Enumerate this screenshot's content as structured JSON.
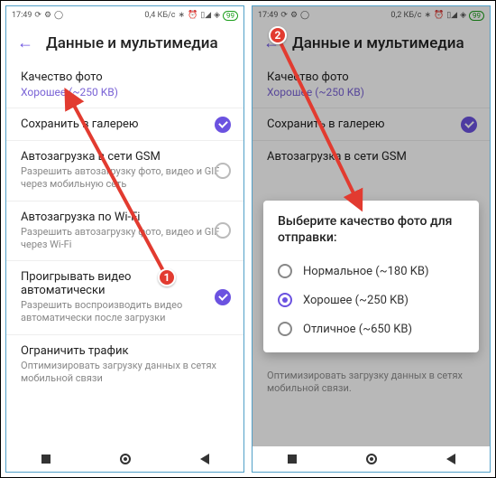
{
  "statusbar": {
    "time": "17:49",
    "net_left": "0,4 КБ/с",
    "net_right": "0,2 КБ/с",
    "batt_left": "99",
    "batt_right": "99"
  },
  "header": {
    "title": "Данные и мультимедиа"
  },
  "photo": {
    "label": "Качество фото",
    "value": "Хорошее (~250 KB)"
  },
  "gallery": {
    "label": "Сохранить в галерею"
  },
  "gsm": {
    "label": "Автозагрузка в сети GSM",
    "sub": "Разрешить автозагрузку фото, видео и GIF через мобильную сеть"
  },
  "wifi": {
    "label": "Автозагрузка по Wi-Fi",
    "sub": "Разрешить автозагрузку фото, видео и GIF через Wi-Fi"
  },
  "video": {
    "label": "Проигрывать видео автоматически",
    "sub": "Разрешить воспроизводить видео автоматически после загрузки"
  },
  "traffic": {
    "label": "Ограничить трафик",
    "sub": "Оптимизировать загрузку данных в сетях мобильной связи"
  },
  "traffic_short": {
    "sub": "Оптимизировать загрузку данных в сетях мобильной связи."
  },
  "dialog": {
    "title": "Выберите качество фото для отправки:",
    "opt1": "Нормальное (~180 KB)",
    "opt2": "Хорошее (~250 KB)",
    "opt3": "Отличное (~650 KB)"
  },
  "badges": {
    "one": "1",
    "two": "2"
  }
}
